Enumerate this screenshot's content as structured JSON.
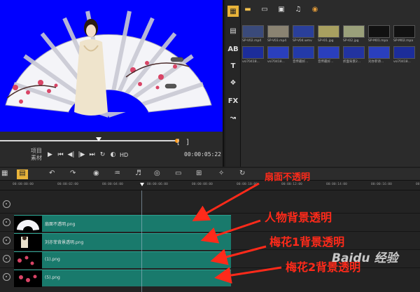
{
  "preview": {
    "mode_labels": [
      "项目",
      "素材"
    ],
    "hd_label": "HD",
    "timecode": "00:00:05:22",
    "trim_in": "[",
    "trim_out": "]"
  },
  "library": {
    "row1": [
      {
        "caption": "SP-V02.mp4",
        "color": "#3a4a7a"
      },
      {
        "caption": "SP-V03.mp4",
        "color": "#8a8372"
      },
      {
        "caption": "SP-V04.wmv",
        "color": "#2a3f9a"
      },
      {
        "caption": "SP-I01.jpg",
        "color": "#a8a060"
      },
      {
        "caption": "SP-I02.jpg",
        "color": "#9aa07a"
      },
      {
        "caption": "SP-M01.mpa",
        "color": "#111111"
      },
      {
        "caption": "SP-M02.mpa",
        "color": "#111111"
      }
    ],
    "row2": [
      {
        "caption": "vsi70418...",
        "color": "#1c2d9a"
      },
      {
        "caption": "vsi70418...",
        "color": "#2a3fbd"
      },
      {
        "caption": "音传最好...",
        "color": "#233aa8"
      },
      {
        "caption": "音传最好...",
        "color": "#2a3fbd"
      },
      {
        "caption": "折面背景2...",
        "color": "#2233a0"
      },
      {
        "caption": "刘亦菲诗...",
        "color": "#2a3fbd"
      },
      {
        "caption": "vsi70418...",
        "color": "#1c2d9a"
      }
    ]
  },
  "timeline": {
    "ruler_ticks": [
      "00:00:00:00",
      "00:00:02:00",
      "00:00:04:00",
      "00:00:06:00",
      "00:00:08:00",
      "00:00:10:00",
      "00:00:12:00",
      "00:00:14:00",
      "00:00:16:00",
      "00:00:18:00"
    ],
    "clips": [
      {
        "label": "扇面不透明.png"
      },
      {
        "label": "刘亦菲背景透明.png"
      },
      {
        "label": "(1).png"
      },
      {
        "label": "(5).png"
      }
    ]
  },
  "annotations": [
    {
      "text": "扇面不透明"
    },
    {
      "text": "人物背景透明"
    },
    {
      "text": "梅花1背景透明"
    },
    {
      "text": "梅花2背景透明"
    }
  ],
  "watermark": "Baidu 经验",
  "colors": {
    "preview_bg": "#0000ff",
    "clip": "#197a6c",
    "annotation": "#ff2a1a",
    "scrub_end": "#ff9a1a"
  },
  "icons": [
    "play-icon",
    "step-back-icon",
    "step-forward-icon",
    "repeat-icon",
    "volume-icon",
    "undo-icon",
    "redo-icon",
    "folder-icon",
    "music-icon",
    "title-icon",
    "fx-icon",
    "path-icon"
  ]
}
